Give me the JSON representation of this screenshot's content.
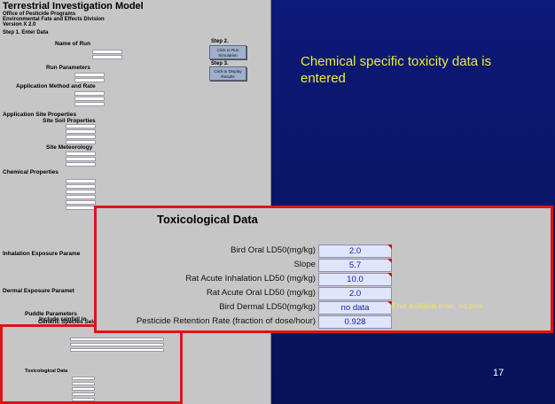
{
  "caption": "Chemical specific toxicity data is entered",
  "page_number": "17",
  "sheet": {
    "title": "Terrestrial Investigation Model",
    "subtitle_1": "Office of Pesticide Programs",
    "subtitle_2": "Environmental Fate and Effects Division",
    "subtitle_3": "Version X 2.0",
    "step1": "Step 1. Enter Data",
    "step2": "Step 2.",
    "step3": "Step 3.",
    "run_sim_button": "Click to Run Simulation",
    "display_button": "Click to Display Results",
    "sections": {
      "name_of_run": "Name of Run",
      "run_parameters": "Run Parameters",
      "application_method": "Application Method and Rate",
      "application_site": "Application Site Properties",
      "site_soil": "Site Soil Properties",
      "site_meteorology": "Site Meteorology",
      "chemical_properties": "Chemical Properties",
      "inhalation": "Inhalation Exposure Parame",
      "dermal": "Dermal Exposure Paramet",
      "puddle": "Puddle Parameters",
      "puddle_sub": "Include rainfall in",
      "generic_species": "Generic Species Selection"
    },
    "inset_title": "Toxicological Data"
  },
  "callout": {
    "title": "Toxicological Data",
    "rows": [
      {
        "label": "Bird Oral LD50(mg/kg)",
        "value": "2.0"
      },
      {
        "label": "Slope",
        "value": "5.7"
      },
      {
        "label": "Rat Acute Inhalation LD50 (mg/kg)",
        "value": "10.0"
      },
      {
        "label": "Rat Acute Oral LD50 (mg/kg)",
        "value": "2.0"
      },
      {
        "label": "Bird Dermal LD50(mg/kg)",
        "value": "no data"
      },
      {
        "label": "Pesticide Retention Rate (fraction of dose/hour)",
        "value": "0.928"
      }
    ],
    "note": "If not available enter:  no data"
  },
  "colors": {
    "background": "#0a1565",
    "highlight_border": "#e01414",
    "caption_text": "#f0ea3a",
    "value_text": "#1b1bb0"
  }
}
